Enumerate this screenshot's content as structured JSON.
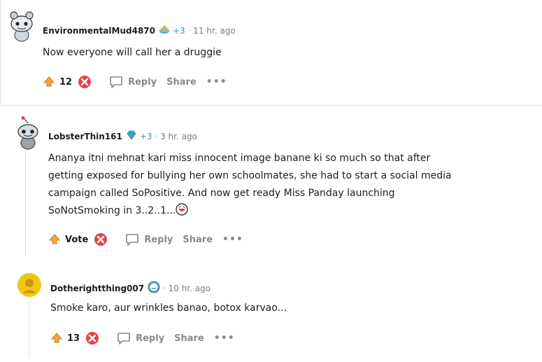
{
  "comments": [
    {
      "username": "EnvironmentalMud4870",
      "flair_icon": "reddit-coin-icon",
      "karma": "+3",
      "separator": "·",
      "time": "11 hr. ago",
      "body": "Now everyone will call her a druggie",
      "vote": "12",
      "reply_label": "Reply",
      "share_label": "Share",
      "more_label": "•••"
    },
    {
      "username": "LobsterThin161",
      "flair_icon": "diamond-icon",
      "karma": "+3",
      "separator": "·",
      "time": "3 hr. ago",
      "body_lines": [
        "Ananya itni mehnat kari miss innocent image banane ki so much so that after",
        "getting exposed for bullying her own schoolmates, she had to start a social media",
        "campaign called SoPositive. And now get ready Miss Panday launching",
        "SoNotSmoking in 3..2..1..."
      ],
      "vote": "Vote",
      "reply_label": "Reply",
      "share_label": "Share",
      "more_label": "•••"
    },
    {
      "username": "Dotherightthing007",
      "flair_icon": "smile-badge-icon",
      "separator": "·",
      "time": "10 hr. ago",
      "body": "Smoke karo, aur wrinkles banao, botox karvao...",
      "vote": "13",
      "reply_label": "Reply",
      "share_label": "Share",
      "more_label": "•••"
    }
  ],
  "colors": {
    "upvote_gold": "#f0a63a",
    "downvote_red": "#e5434a",
    "meta_gray": "#7c7c7c",
    "karma_blue": "#4a8ab5"
  }
}
